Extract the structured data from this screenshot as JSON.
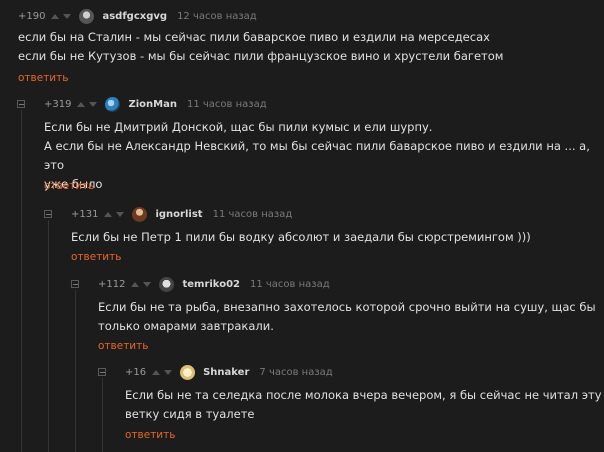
{
  "colors": {
    "background": "#1c1c1c",
    "text": "#e0e0e0",
    "reply": "#e5672b",
    "muted": "#7a7a7a"
  },
  "comments": [
    {
      "rating": "+190",
      "author": "asdfgcxgvg",
      "time": "12 часов назад",
      "avatar_icon": "user-avatar-icon",
      "lines": [
        "если бы на Сталин - мы сейчас пили баварское пиво и ездили на мерседесах",
        "если бы не Кутузов - мы бы сейчас пили французское вино и хрустели багетом"
      ],
      "reply": "ответить"
    },
    {
      "rating": "+319",
      "author": "ZionMan",
      "time": "11 часов назад",
      "avatar_icon": "user-avatar-icon",
      "lines": [
        "Если бы не Дмитрий Донской, щас бы пили кумыс и ели шурпу.",
        "А если бы не Александр Невский, то мы бы сейчас пили баварское пиво и ездили на ... а, это",
        "уже было"
      ],
      "reply": "ответить"
    },
    {
      "rating": "+131",
      "author": "ignorlist",
      "time": "11 часов назад",
      "avatar_icon": "user-avatar-icon",
      "lines": [
        "Если бы не Петр 1 пили бы водку абсолют и заедали бы сюрстремингом )))"
      ],
      "reply": "ответить"
    },
    {
      "rating": "+112",
      "author": "temriko02",
      "time": "11 часов назад",
      "avatar_icon": "user-avatar-icon",
      "lines": [
        "Если бы не та рыба, внезапно захотелось которой срочно выйти на сушу, щас бы",
        "только омарами завтракали."
      ],
      "reply": "ответить"
    },
    {
      "rating": "+16",
      "author": "Shnaker",
      "time": "7 часов назад",
      "avatar_icon": "user-avatar-icon",
      "lines": [
        "Если бы не та селедка после молока вчера вечером, я бы сейчас не читал эту",
        "ветку сидя в туалете"
      ],
      "reply": "ответить"
    }
  ]
}
